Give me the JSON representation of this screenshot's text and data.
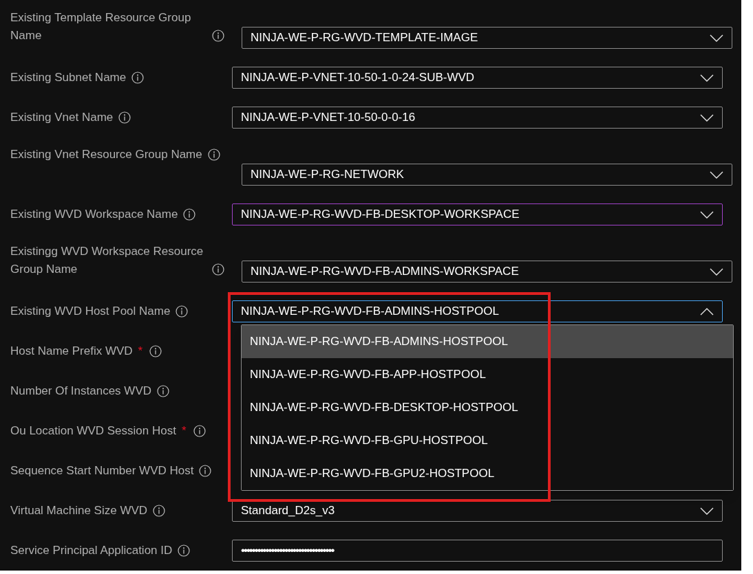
{
  "fields": [
    {
      "label": "Existing Template Resource Group Name",
      "required": false,
      "wrapped": true,
      "field": {
        "kind": "dropdown",
        "value": "NINJA-WE-P-RG-WVD-TEMPLATE-IMAGE",
        "expanded": false,
        "hovered": false
      }
    },
    {
      "label": "Existing Subnet Name",
      "required": false,
      "wrapped": false,
      "field": {
        "kind": "dropdown",
        "value": "NINJA-WE-P-VNET-10-50-1-0-24-SUB-WVD",
        "expanded": false,
        "hovered": false
      }
    },
    {
      "label": "Existing Vnet Name",
      "required": false,
      "wrapped": false,
      "field": {
        "kind": "dropdown",
        "value": "NINJA-WE-P-VNET-10-50-0-0-16",
        "expanded": false,
        "hovered": false
      }
    },
    {
      "label": "Existing Vnet Resource Group Name",
      "required": false,
      "wrapped": true,
      "field": {
        "kind": "dropdown",
        "value": "NINJA-WE-P-RG-NETWORK",
        "expanded": false,
        "hovered": false
      }
    },
    {
      "label": "Existing WVD Workspace Name",
      "required": false,
      "wrapped": false,
      "field": {
        "kind": "dropdown",
        "value": "NINJA-WE-P-RG-WVD-FB-DESKTOP-WORKSPACE",
        "expanded": false,
        "hovered": true
      }
    },
    {
      "label": "Existingg WVD Workspace Resource Group Name",
      "required": false,
      "wrapped": true,
      "field": {
        "kind": "dropdown",
        "value": "NINJA-WE-P-RG-WVD-FB-ADMINS-WORKSPACE",
        "expanded": false,
        "hovered": false
      }
    },
    {
      "label": "Existing WVD Host Pool Name",
      "required": false,
      "wrapped": false,
      "field": {
        "kind": "dropdown",
        "value": "NINJA-WE-P-RG-WVD-FB-ADMINS-HOSTPOOL",
        "expanded": true,
        "hovered": false
      }
    },
    {
      "label": "Host Name Prefix WVD",
      "required": true,
      "wrapped": false
    },
    {
      "label": "Number Of Instances WVD",
      "required": false,
      "wrapped": false
    },
    {
      "label": "Ou Location WVD Session Host",
      "required": true,
      "wrapped": false
    },
    {
      "label": "Sequence Start Number WVD Host",
      "required": false,
      "wrapped": false
    },
    {
      "label": "Virtual Machine Size WVD",
      "required": false,
      "wrapped": false,
      "field": {
        "kind": "dropdown",
        "value": "Standard_D2s_v3",
        "expanded": false,
        "hovered": false
      }
    },
    {
      "label": "Service Principal Application ID",
      "required": false,
      "wrapped": false,
      "field": {
        "kind": "password",
        "value": "••••••••••••••••••••••••••••••••••"
      }
    }
  ],
  "required_mark": "*",
  "dropdown_options": [
    {
      "label": "NINJA-WE-P-RG-WVD-FB-ADMINS-HOSTPOOL",
      "selected": true
    },
    {
      "label": "NINJA-WE-P-RG-WVD-FB-APP-HOSTPOOL",
      "selected": false
    },
    {
      "label": "NINJA-WE-P-RG-WVD-FB-DESKTOP-HOSTPOOL",
      "selected": false
    },
    {
      "label": "NINJA-WE-P-RG-WVD-FB-GPU-HOSTPOOL",
      "selected": false
    },
    {
      "label": "NINJA-WE-P-RG-WVD-FB-GPU2-HOSTPOOL",
      "selected": false
    }
  ],
  "annotation": {
    "kind": "highlight-rectangle",
    "color": "#e02020"
  }
}
